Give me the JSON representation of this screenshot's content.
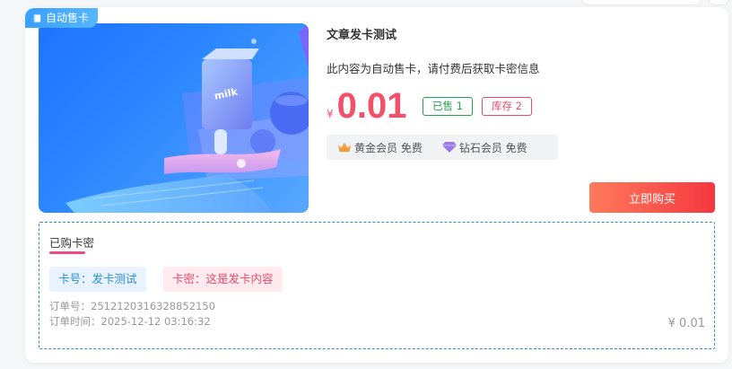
{
  "badge": {
    "label": "自动售卡",
    "icon": "book-icon"
  },
  "product": {
    "title": "文章发卡测试",
    "description": "此内容为自动售卡，请付费后获取卡密信息",
    "currency_symbol": "¥",
    "price": "0.01",
    "sold_label": "已售 1",
    "stock_label": "库存 2",
    "thumbnail_icon": "milk-carton-image"
  },
  "members": [
    {
      "label": "黄金会员 免费",
      "icon": "crown-icon",
      "color": "#f29b38"
    },
    {
      "label": "钻石会员 免费",
      "icon": "diamond-icon",
      "color": "#9b7be6"
    }
  ],
  "buy_button": {
    "label": "立即购买"
  },
  "bought": {
    "title": "已购卡密",
    "card_no": "卡号：发卡测试",
    "card_secret": "卡密：这是发卡内容",
    "order_no": "订单号：2512120316328852150",
    "order_time": "订单时间：2025-12-12 03:16:32",
    "amount": "¥ 0.01"
  },
  "colors": {
    "accent": "#f5506a",
    "primary": "#2a8fd0",
    "success": "#22a54a"
  }
}
